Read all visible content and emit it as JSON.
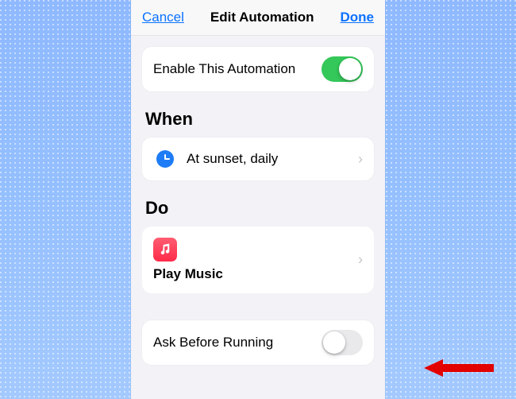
{
  "navbar": {
    "cancel": "Cancel",
    "title": "Edit Automation",
    "done": "Done"
  },
  "enable_row": {
    "label": "Enable This Automation",
    "toggle_on": true
  },
  "when": {
    "header": "When",
    "schedule": "At sunset, daily"
  },
  "do": {
    "header": "Do",
    "action_name": "Play Music"
  },
  "ask_row": {
    "label": "Ask Before Running",
    "toggle_on": false
  }
}
